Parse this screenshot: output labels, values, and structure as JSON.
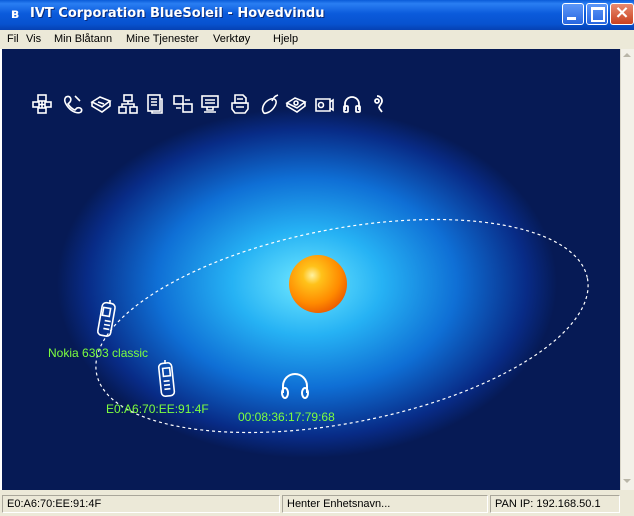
{
  "window": {
    "title": "IVT Corporation BlueSoleil - Hovedvindu",
    "icon": "bluetooth-icon"
  },
  "menu": {
    "items": [
      "Fil",
      "Vis",
      "Min Blåtann",
      "Mine Tjenester",
      "Verktøy",
      "Hjelp"
    ]
  },
  "toolbar": {
    "services": [
      "network-access-icon",
      "dialup-icon",
      "fax-icon",
      "pan-network-icon",
      "file-transfer-icon",
      "sync-icon",
      "serial-port-icon",
      "print-icon",
      "hid-mouse-icon",
      "bip-camera-icon",
      "ftp-icon",
      "audio-headset-icon",
      "headset-mic-icon"
    ]
  },
  "devices": [
    {
      "name": "Nokia 6303 classic",
      "icon": "mobile-phone-icon"
    },
    {
      "name": "E0:A6:70:EE:91:4F",
      "icon": "mobile-phone-icon"
    },
    {
      "name": "00:08:36:17:79:68",
      "icon": "headphones-icon"
    }
  ],
  "status": {
    "address": "E0:A6:70:EE:91:4F",
    "message": "Henter Enhetsnavn...",
    "pan_ip": "PAN IP: 192.168.50.1"
  },
  "colors": {
    "titlebar": "#0b5bdc",
    "label": "#7dff3e",
    "background_dark": "#061a55",
    "glow": "#26b2f4"
  }
}
